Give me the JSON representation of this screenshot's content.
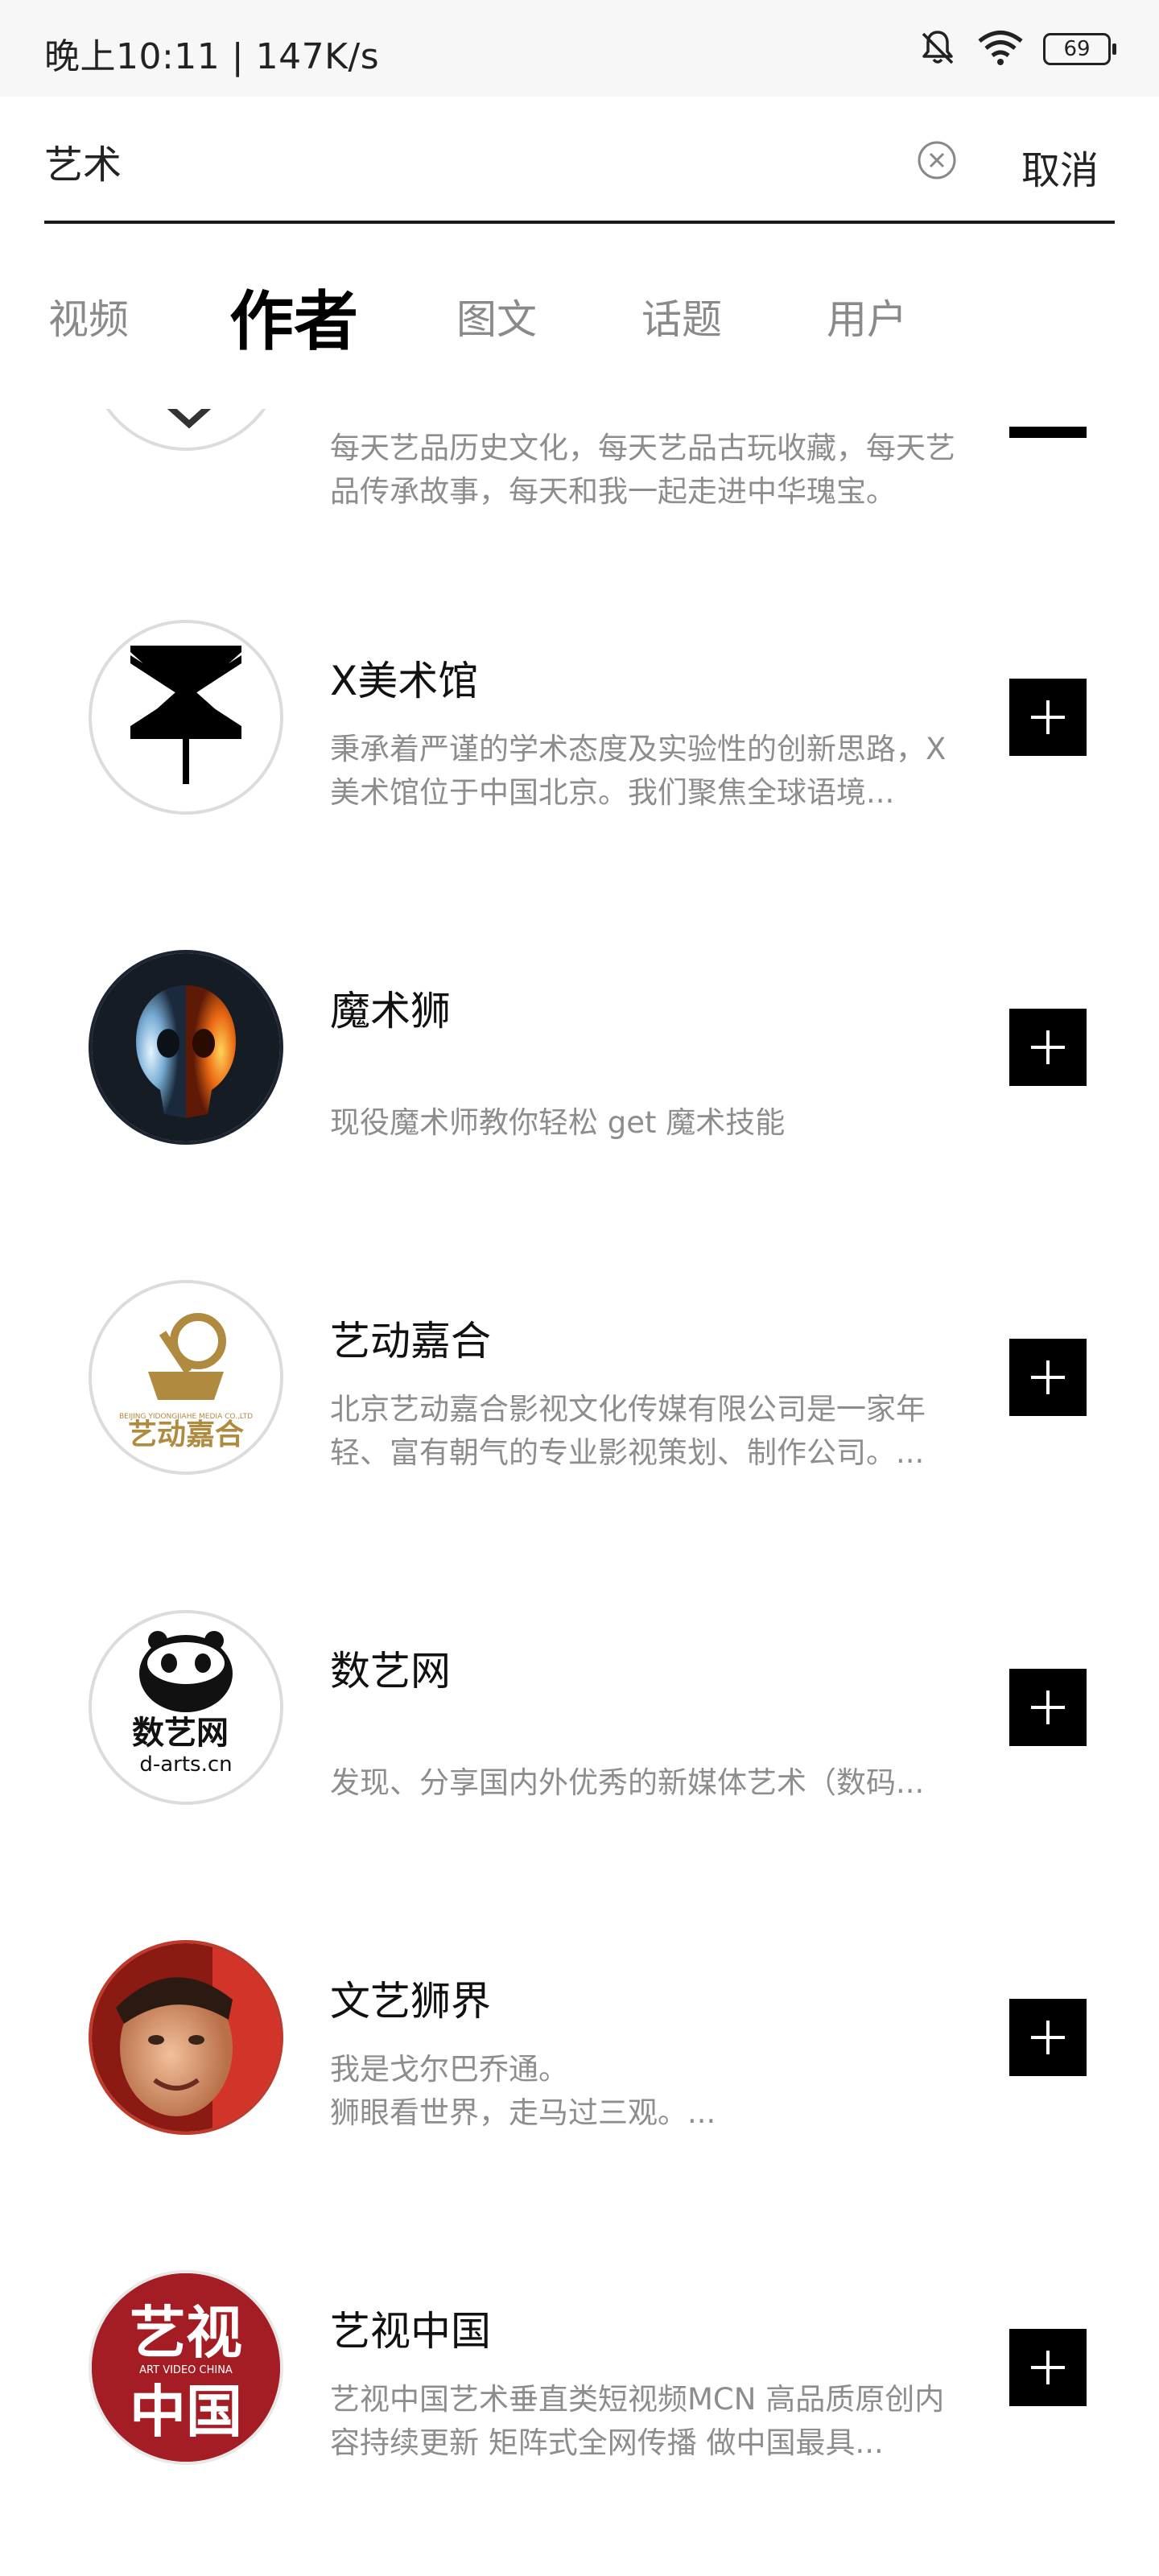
{
  "status_bar": {
    "time": "晚上10:11 | 147K/s",
    "battery": "69",
    "icons": [
      "bell-muted-icon",
      "wifi-icon",
      "battery-icon"
    ]
  },
  "search": {
    "query": "艺术",
    "placeholder": "",
    "cancel_label": "取消"
  },
  "tabs": [
    {
      "label": "视频",
      "active": false
    },
    {
      "label": "作者",
      "active": true
    },
    {
      "label": "图文",
      "active": false
    },
    {
      "label": "话题",
      "active": false
    },
    {
      "label": "用户",
      "active": false
    }
  ],
  "authors": [
    {
      "name": "",
      "desc": "每天艺品历史文化，每天艺品古玩收藏，每天艺品传承故事，每天和我一起走进中华瑰宝。",
      "avatar": "geometric-lines-logo",
      "followed": false
    },
    {
      "name": "X美术馆",
      "desc": "秉承着严谨的学术态度及实验性的创新思路，X美术馆位于中国北京。我们聚焦全球语境...",
      "avatar": "x-museum-logo",
      "followed": false
    },
    {
      "name": "魔术狮",
      "desc": "现役魔术师教你轻松 get 魔术技能",
      "avatar": "fire-ice-skull",
      "followed": false
    },
    {
      "name": "艺动嘉合",
      "desc": "北京艺动嘉合影视文化传媒有限公司是一家年轻、富有朝气的专业影视策划、制作公司。...",
      "avatar": "film-reel-logo",
      "avatar_text": "艺动嘉合",
      "avatar_subtext": "BEIJING YIDONGJIAHE MEDIA CO.,LTD",
      "followed": false
    },
    {
      "name": "数艺网",
      "desc": "发现、分享国内外优秀的新媒体艺术（数码...",
      "avatar": "panda-logo",
      "avatar_text": "数艺网",
      "avatar_subtext": "d-arts.cn",
      "followed": false
    },
    {
      "name": "文艺狮界",
      "desc": "我是戈尔巴乔通。\n狮眼看世界，走马过三观。...",
      "avatar": "person-photo",
      "followed": false
    },
    {
      "name": "艺视中国",
      "desc": "艺视中国艺术垂直类短视频MCN  高品质原创内容持续更新 矩阵式全网传播  做中国最具...",
      "avatar": "yishi-china-logo",
      "avatar_text_1": "艺视",
      "avatar_text_2": "中国",
      "avatar_subtext": "ART VIDEO CHINA",
      "followed": false
    }
  ],
  "colors": {
    "accent": "#000000",
    "muted_text": "#8d8d8d",
    "status_bg": "#f7f7f7",
    "yishi_red": "#a51d24",
    "yidong_gold": "#b08a3e"
  }
}
